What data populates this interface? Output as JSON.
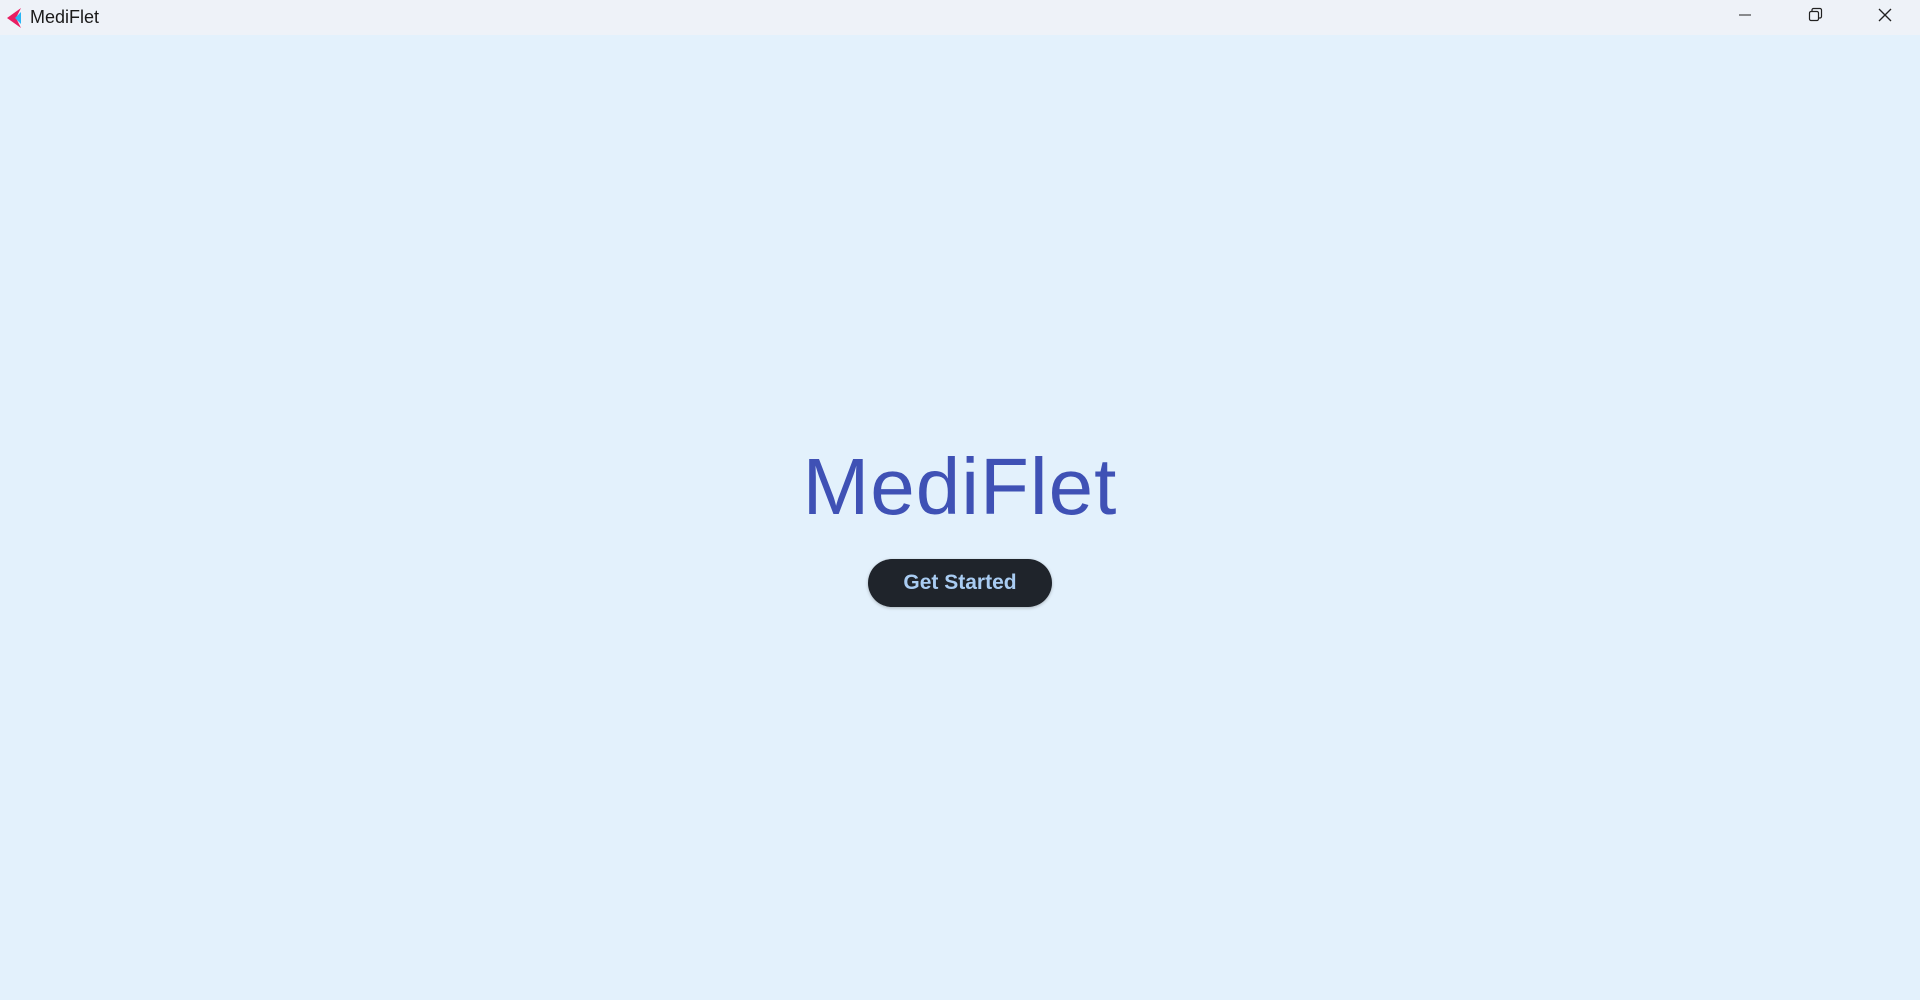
{
  "window": {
    "title": "MediFlet",
    "icon": "flet-logo-icon",
    "controls": {
      "minimize_icon": "minimize-icon",
      "restore_icon": "restore-icon",
      "close_icon": "close-icon"
    }
  },
  "main": {
    "heading": "MediFlet",
    "cta_label": "Get Started"
  },
  "colors": {
    "background": "#e3f1fc",
    "titlebar": "#eef2f8",
    "heading": "#3f51b5",
    "button_bg": "#1f242b",
    "button_text": "#a9ccf2"
  }
}
